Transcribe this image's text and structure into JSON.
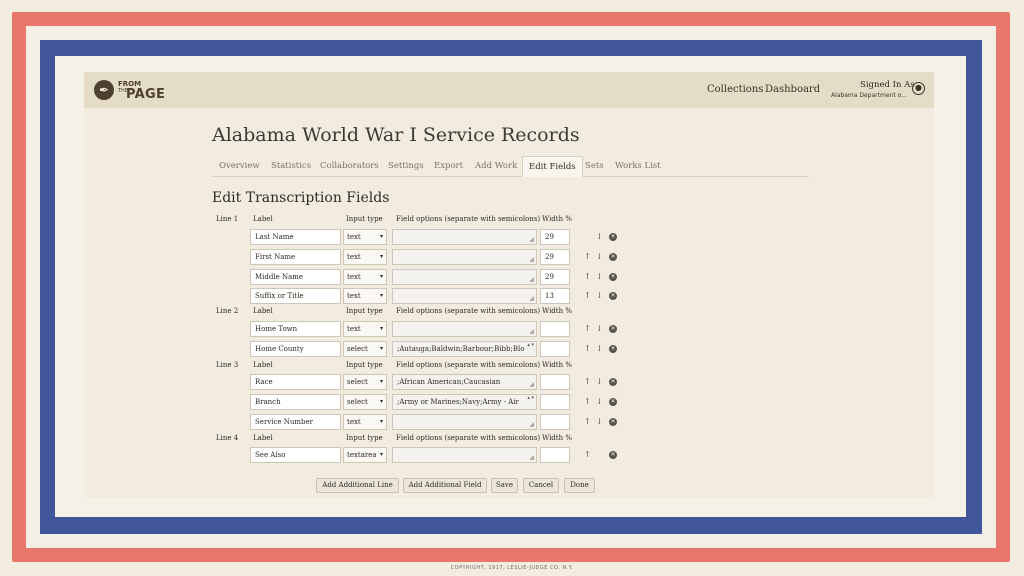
{
  "brand": {
    "logo_from": "FROM",
    "logo_the": "THE",
    "logo_page": "PAGE",
    "logo_glyph": "quill-icon"
  },
  "nav": {
    "collections": "Collections",
    "dashboard": "Dashboard",
    "signed_in": "Signed In As",
    "org": "Alabama Department o..."
  },
  "page_title": "Alabama World War I Service Records",
  "tabs": [
    "Overview",
    "Statistics",
    "Collaborators",
    "Settings",
    "Export",
    "Add Work",
    "Edit Fields",
    "Sets",
    "Works List"
  ],
  "active_tab": "Edit Fields",
  "section_title": "Edit Transcription Fields",
  "headers": {
    "label": "Label",
    "input_type": "Input type",
    "field_options": "Field options (separate with semicolons)",
    "width": "Width %"
  },
  "lines": [
    {
      "name": "Line 1",
      "fields": [
        {
          "label": "Last Name",
          "type": "text",
          "options": "",
          "width": "29"
        },
        {
          "label": "First Name",
          "type": "text",
          "options": "",
          "width": "29"
        },
        {
          "label": "Middle Name",
          "type": "text",
          "options": "",
          "width": "29"
        },
        {
          "label": "Suffix or Title",
          "type": "text",
          "options": "",
          "width": "13"
        }
      ]
    },
    {
      "name": "Line 2",
      "fields": [
        {
          "label": "Home Town",
          "type": "text",
          "options": "",
          "width": ""
        },
        {
          "label": "Home County",
          "type": "select",
          "options": ";Autauga;Baldwin;Barbour;Bibb;Blo",
          "width": ""
        }
      ]
    },
    {
      "name": "Line 3",
      "fields": [
        {
          "label": "Race",
          "type": "select",
          "options": ";African American;Caucasian",
          "width": ""
        },
        {
          "label": "Branch",
          "type": "select",
          "options": ";Army or Marines;Navy;Army - Air",
          "width": ""
        },
        {
          "label": "Service Number",
          "type": "text",
          "options": "",
          "width": ""
        }
      ]
    },
    {
      "name": "Line 4",
      "fields": [
        {
          "label": "See Also",
          "type": "textarea",
          "options": "",
          "width": ""
        }
      ]
    }
  ],
  "buttons": {
    "add_line": "Add Additional Line",
    "add_field": "Add Additional Field",
    "save": "Save",
    "cancel": "Cancel",
    "done": "Done"
  },
  "footer": {
    "copyright": "COPYRIGHT, 1917, LESLIE-JUDGE CO. N.Y."
  },
  "colors": {
    "frame_red": "#e9786a",
    "frame_blue": "#40559a",
    "topbar": "#e4dcc6",
    "background": "#f1ebe0"
  }
}
